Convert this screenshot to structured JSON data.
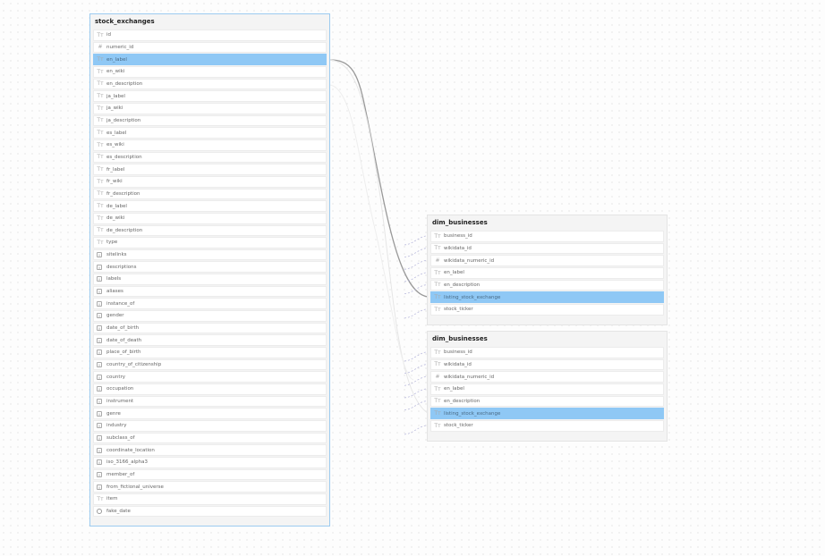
{
  "tables": [
    {
      "title": "stock_exchanges",
      "fields": [
        {
          "name": "id",
          "type": "text"
        },
        {
          "name": "numeric_id",
          "type": "number"
        },
        {
          "name": "en_label",
          "type": "text",
          "highlighted": true
        },
        {
          "name": "en_wiki",
          "type": "text"
        },
        {
          "name": "en_description",
          "type": "text"
        },
        {
          "name": "ja_label",
          "type": "text"
        },
        {
          "name": "ja_wiki",
          "type": "text"
        },
        {
          "name": "ja_description",
          "type": "text"
        },
        {
          "name": "es_label",
          "type": "text"
        },
        {
          "name": "es_wiki",
          "type": "text"
        },
        {
          "name": "es_description",
          "type": "text"
        },
        {
          "name": "fr_label",
          "type": "text"
        },
        {
          "name": "fr_wiki",
          "type": "text"
        },
        {
          "name": "fr_description",
          "type": "text"
        },
        {
          "name": "de_label",
          "type": "text"
        },
        {
          "name": "de_wiki",
          "type": "text"
        },
        {
          "name": "de_description",
          "type": "text"
        },
        {
          "name": "type",
          "type": "text"
        },
        {
          "name": "sitelinks",
          "type": "object"
        },
        {
          "name": "descriptions",
          "type": "object"
        },
        {
          "name": "labels",
          "type": "object"
        },
        {
          "name": "aliases",
          "type": "object"
        },
        {
          "name": "instance_of",
          "type": "object"
        },
        {
          "name": "gender",
          "type": "object"
        },
        {
          "name": "date_of_birth",
          "type": "object"
        },
        {
          "name": "date_of_death",
          "type": "object"
        },
        {
          "name": "place_of_birth",
          "type": "object"
        },
        {
          "name": "country_of_citizenship",
          "type": "object"
        },
        {
          "name": "country",
          "type": "object"
        },
        {
          "name": "occupation",
          "type": "object"
        },
        {
          "name": "instrument",
          "type": "object"
        },
        {
          "name": "genre",
          "type": "object"
        },
        {
          "name": "industry",
          "type": "object"
        },
        {
          "name": "subclass_of",
          "type": "object"
        },
        {
          "name": "coordinate_location",
          "type": "object"
        },
        {
          "name": "iso_3166_alpha3",
          "type": "object"
        },
        {
          "name": "member_of",
          "type": "object"
        },
        {
          "name": "from_fictional_universe",
          "type": "object"
        },
        {
          "name": "item",
          "type": "text"
        },
        {
          "name": "fake_date",
          "type": "datetime"
        }
      ]
    },
    {
      "title": "dim_businesses",
      "fields": [
        {
          "name": "business_id",
          "type": "text"
        },
        {
          "name": "wikidata_id",
          "type": "text"
        },
        {
          "name": "wikidata_numeric_id",
          "type": "number"
        },
        {
          "name": "en_label",
          "type": "text"
        },
        {
          "name": "en_description",
          "type": "text"
        },
        {
          "name": "listing_stock_exchange",
          "type": "text",
          "highlighted": true
        },
        {
          "name": "stock_ticker",
          "type": "text"
        }
      ]
    },
    {
      "title": "dim_businesses",
      "fields": [
        {
          "name": "business_id",
          "type": "text"
        },
        {
          "name": "wikidata_id",
          "type": "text"
        },
        {
          "name": "wikidata_numeric_id",
          "type": "number"
        },
        {
          "name": "en_label",
          "type": "text"
        },
        {
          "name": "en_description",
          "type": "text"
        },
        {
          "name": "listing_stock_exchange",
          "type": "text",
          "highlighted": true
        },
        {
          "name": "stock_ticker",
          "type": "text"
        }
      ]
    }
  ],
  "colors": {
    "highlight": "#8fc8f5",
    "selected_border": "#9ccbf0",
    "link": "#999999",
    "dashed": "#b8b8e0"
  }
}
